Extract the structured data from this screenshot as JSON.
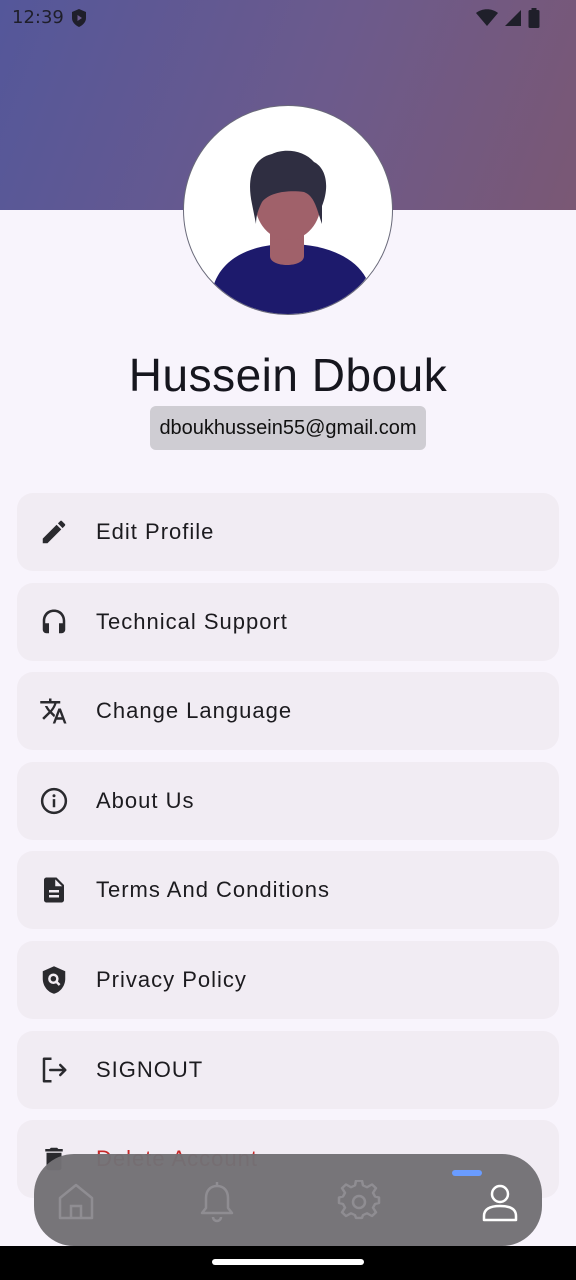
{
  "status_bar": {
    "time": "12:39"
  },
  "profile": {
    "name": "Hussein Dbouk",
    "email": "dboukhussein55@gmail.com"
  },
  "menu": [
    {
      "label": "Edit Profile",
      "icon": "pencil-icon"
    },
    {
      "label": "Technical Support",
      "icon": "headset-icon"
    },
    {
      "label": "Change Language",
      "icon": "translate-icon"
    },
    {
      "label": "About Us",
      "icon": "info-icon"
    },
    {
      "label": "Terms And Conditions",
      "icon": "document-icon"
    },
    {
      "label": "Privacy Policy",
      "icon": "shield-search-icon"
    },
    {
      "label": "SIGNOUT",
      "icon": "logout-icon"
    },
    {
      "label": "Delete Account",
      "icon": "trash-icon"
    }
  ],
  "bottom_nav": [
    {
      "icon": "home-icon",
      "active": false
    },
    {
      "icon": "bell-icon",
      "active": false
    },
    {
      "icon": "settings-icon",
      "active": false
    },
    {
      "icon": "profile-icon",
      "active": true
    }
  ],
  "colors": {
    "header_gradient_start": "#54579a",
    "header_gradient_end": "#7a5874",
    "danger": "#c62828",
    "active_indicator": "#6a9cff",
    "avatar_shirt": "#1d1a6c",
    "avatar_hair": "#2f2e41",
    "avatar_skin": "#a0616a"
  }
}
